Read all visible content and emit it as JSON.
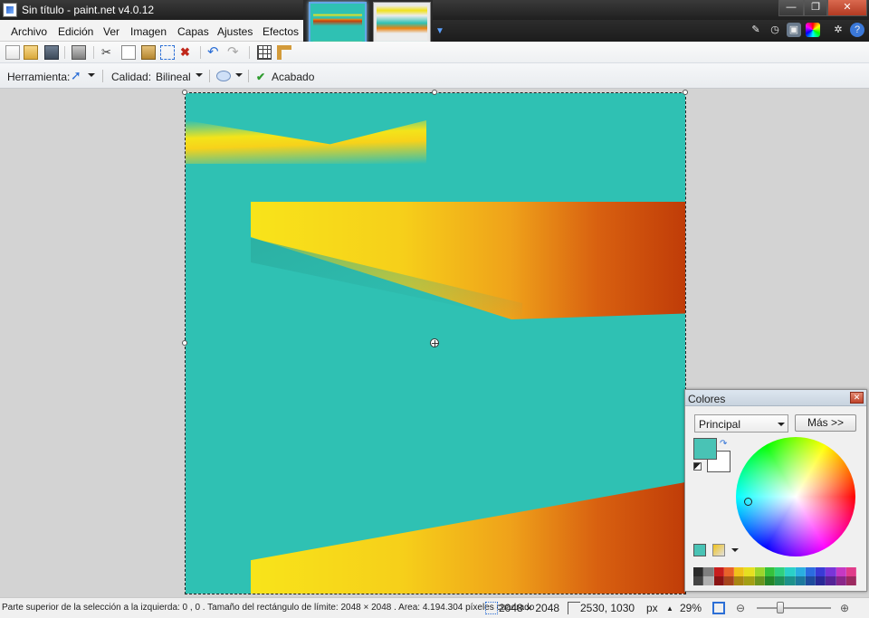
{
  "window": {
    "title": "Sin título - paint.net v4.0.12"
  },
  "menu": {
    "items": [
      "Archivo",
      "Edición",
      "Ver",
      "Imagen",
      "Capas",
      "Ajustes",
      "Efectos"
    ]
  },
  "window_controls": {
    "minimize": "—",
    "restore": "❐",
    "close": "✕"
  },
  "tool_options": {
    "tool_label": "Herramienta:",
    "quality_label": "Calidad:",
    "quality_value": "Bilineal",
    "finish_label": "Acabado"
  },
  "colors_panel": {
    "title": "Colores",
    "mode_value": "Principal",
    "more_button": "Más >>",
    "primary_color": "#49c3b5",
    "secondary_color": "#ffffff"
  },
  "palette": {
    "row1": [
      "#2b2b2b",
      "#7f7f7f",
      "#c81d1d",
      "#e8622a",
      "#f0c21a",
      "#e6e020",
      "#9bd62c",
      "#35c23c",
      "#2fd07f",
      "#2ad0c8",
      "#2aaee0",
      "#2c6ce0",
      "#3a3ad6",
      "#7a35d8",
      "#c638c4",
      "#e03c8a"
    ],
    "row2": [
      "#444444",
      "#b0b0b0",
      "#8a1414",
      "#a7441d",
      "#a98613",
      "#a39f15",
      "#6a951f",
      "#248629",
      "#1f9058",
      "#1d918b",
      "#1d799d",
      "#1f4c9d",
      "#292996",
      "#552597",
      "#8a278a",
      "#9c2a60"
    ]
  },
  "canvas": {
    "background_color": "#2fc1b3"
  },
  "status": {
    "selection_info": "Parte superior de la selección a la izquierda: 0 , 0 . Tamaño del rectángulo de límite: 2048  × 2048 . Area: 4.194.304 píxeles cuadrado",
    "image_size": "2048 × 2048",
    "cursor_position": "2530, 1030",
    "units": "px",
    "zoom": "29%"
  }
}
